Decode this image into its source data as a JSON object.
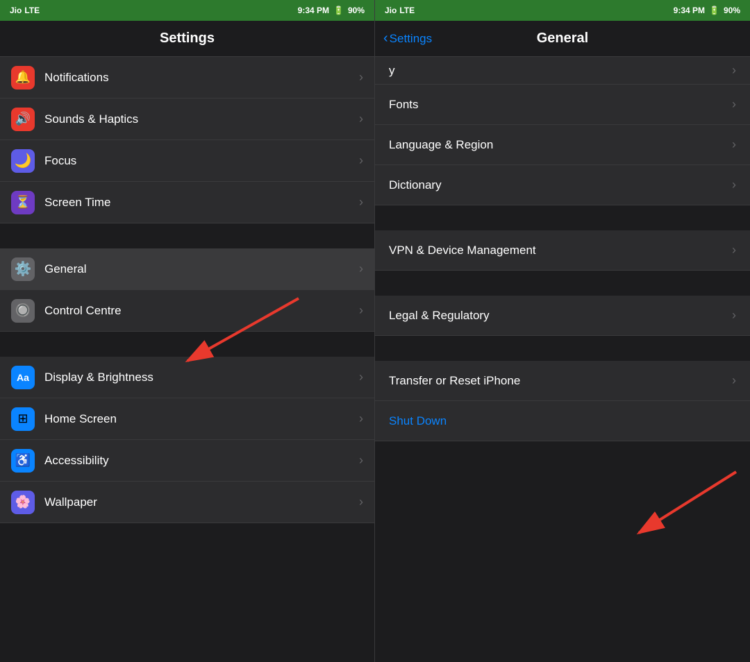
{
  "left_panel": {
    "status_bar": {
      "carrier": "Jio",
      "network": "LTE",
      "time": "9:34 PM",
      "battery": "90%"
    },
    "title": "Settings",
    "items": [
      {
        "id": "notifications",
        "label": "Notifications",
        "icon": "🔔",
        "icon_bg": "icon-red"
      },
      {
        "id": "sounds",
        "label": "Sounds & Haptics",
        "icon": "🔊",
        "icon_bg": "icon-red-sound"
      },
      {
        "id": "focus",
        "label": "Focus",
        "icon": "🌙",
        "icon_bg": "icon-purple"
      },
      {
        "id": "screentime",
        "label": "Screen Time",
        "icon": "⏳",
        "icon_bg": "icon-purple-screentime"
      },
      {
        "id": "general",
        "label": "General",
        "icon": "⚙️",
        "icon_bg": "icon-gray",
        "selected": true
      },
      {
        "id": "controlcentre",
        "label": "Control Centre",
        "icon": "🔘",
        "icon_bg": "icon-gray-ctrl"
      },
      {
        "id": "displaybrightness",
        "label": "Display & Brightness",
        "icon": "Aa",
        "icon_bg": "icon-blue-aa"
      },
      {
        "id": "homescreen",
        "label": "Home Screen",
        "icon": "⊞",
        "icon_bg": "icon-home"
      },
      {
        "id": "accessibility",
        "label": "Accessibility",
        "icon": "♿",
        "icon_bg": "icon-access"
      },
      {
        "id": "wallpaper",
        "label": "Wallpaper",
        "icon": "🌸",
        "icon_bg": "icon-wallpaper"
      }
    ],
    "chevron": "›"
  },
  "right_panel": {
    "status_bar": {
      "carrier": "Jio",
      "network": "LTE",
      "time": "9:34 PM",
      "battery": "90%"
    },
    "back_label": "Settings",
    "title": "General",
    "items_group1": [
      {
        "id": "fonts",
        "label": "Fonts"
      },
      {
        "id": "language",
        "label": "Language & Region"
      },
      {
        "id": "dictionary",
        "label": "Dictionary"
      }
    ],
    "items_group2": [
      {
        "id": "vpn",
        "label": "VPN & Device Management"
      }
    ],
    "items_group3": [
      {
        "id": "legal",
        "label": "Legal & Regulatory"
      }
    ],
    "items_group4": [
      {
        "id": "transfer",
        "label": "Transfer or Reset iPhone"
      },
      {
        "id": "shutdown",
        "label": "Shut Down",
        "blue": true
      }
    ],
    "chevron": "›"
  }
}
